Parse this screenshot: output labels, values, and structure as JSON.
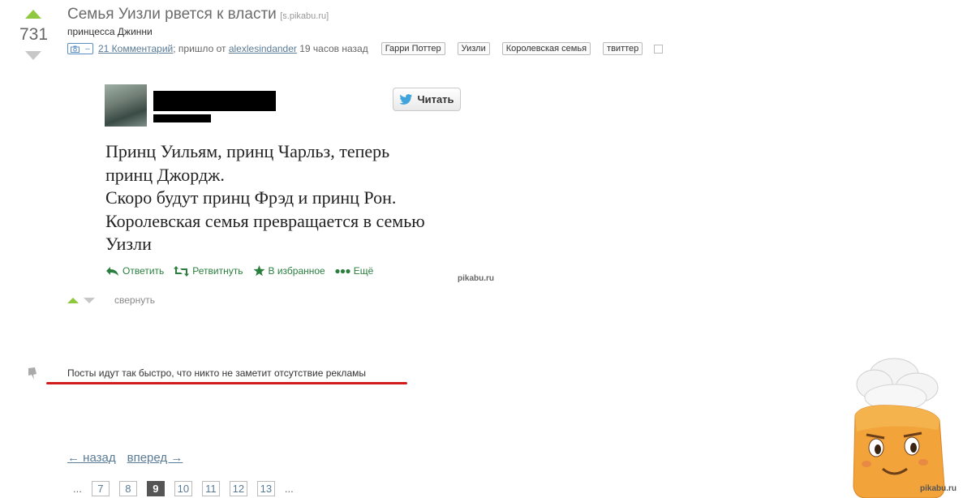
{
  "post": {
    "score": "731",
    "title": "Семья Уизли рвется к власти",
    "source": "[s.pikabu.ru]",
    "subtitle": "принцесса Джинни",
    "comments": "21 Комментарий",
    "from_text": "; пришло от",
    "author": "alexlesindander",
    "time": "19 часов назад",
    "camera_dash": "–",
    "tags": [
      "Гарри Поттер",
      "Уизли",
      "Королевская семья",
      "твиттер"
    ]
  },
  "tweet": {
    "follow_label": "Читать",
    "text": "Принц Уильям, принц Чарльз, теперь\nпринц Джордж.\nСкоро будут принц Фрэд и принц Рон.\nКоролевская семья превращается в семью\nУизли",
    "actions": {
      "reply": "Ответить",
      "retweet": "Ретвитнуть",
      "favorite": "В избранное",
      "more": "Ещё"
    },
    "watermark": "pikabu.ru"
  },
  "collapse_label": "свернуть",
  "notice": "Посты идут так быстро, что никто не заметит отсутствие рекламы",
  "pagination": {
    "prev": "← назад",
    "next": "вперед →",
    "ellipsis": "...",
    "pages": [
      "7",
      "8",
      "9",
      "10",
      "11",
      "12",
      "13"
    ],
    "current": "9"
  },
  "mascot_watermark": "pikabu.ru",
  "colors": {
    "upvote": "#8fc83f",
    "link": "#5a7b96",
    "tweet_action": "#2a7f3e",
    "underline": "#d21b1b"
  }
}
